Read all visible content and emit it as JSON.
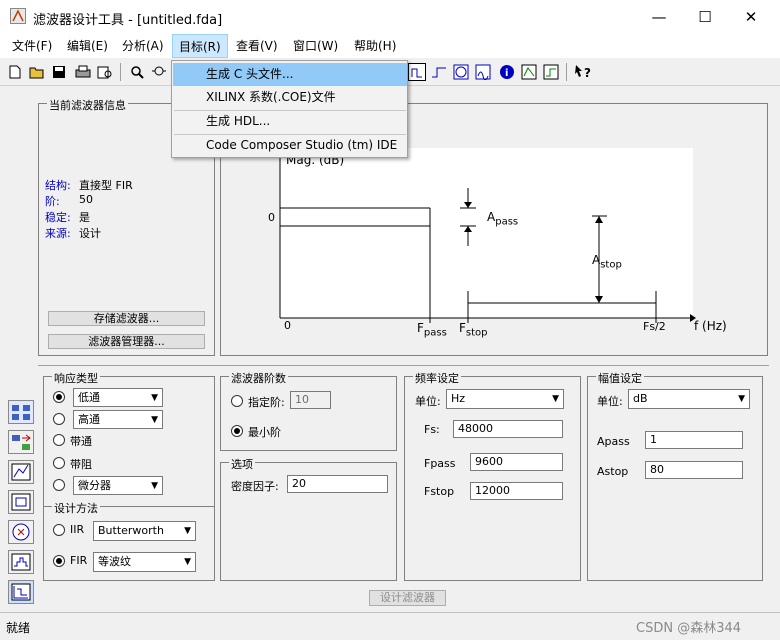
{
  "window": {
    "title": "滤波器设计工具 - [untitled.fda]",
    "minimize": "—",
    "maximize": "☐",
    "close": "✕"
  },
  "menubar": {
    "items": [
      "文件(F)",
      "编辑(E)",
      "分析(A)",
      "目标(R)",
      "查看(V)",
      "窗口(W)",
      "帮助(H)"
    ]
  },
  "dropdown": {
    "items": [
      "生成 C 头文件...",
      "XILINX 系数(.COE)文件",
      "生成 HDL...",
      "Code Composer Studio (tm) IDE"
    ]
  },
  "info_panel": {
    "legend": "当前滤波器信息",
    "rows": [
      {
        "key": "结构:",
        "value": "直接型 FIR"
      },
      {
        "key": "阶:",
        "value": "50"
      },
      {
        "key": "稳定:",
        "value": "是"
      },
      {
        "key": "来源:",
        "value": "设计"
      }
    ],
    "store_button": "存储滤波器...",
    "manager_button": "滤波器管理器..."
  },
  "plot": {
    "ylabel": "Mag. (dB)",
    "zero_y": "0",
    "zero_x": "0",
    "apass": "A",
    "apass_sub": "pass",
    "astop": "A",
    "astop_sub": "stop",
    "fpass": "F",
    "fpass_sub": "pass",
    "fstop": "F",
    "fstop_sub": "stop",
    "fs2": "Fs/2",
    "xlabel": "f (Hz)"
  },
  "response_type": {
    "legend": "响应类型",
    "options": [
      "低通",
      "高通",
      "带通",
      "带阻",
      "微分器"
    ],
    "selected_index": 0
  },
  "design_method": {
    "legend": "设计方法",
    "iir_label": "IIR",
    "iir_value": "Butterworth",
    "fir_label": "FIR",
    "fir_value": "等波纹",
    "selected": "FIR"
  },
  "order": {
    "legend": "滤波器阶数",
    "specify_label": "指定阶:",
    "specify_value": "10",
    "min_label": "最小阶",
    "selected": "min"
  },
  "options": {
    "legend": "选项",
    "density_label": "密度因子:",
    "density_value": "20"
  },
  "freq": {
    "legend": "频率设定",
    "unit_label": "单位:",
    "unit_value": "Hz",
    "fs_label": "Fs:",
    "fs_value": "48000",
    "fpass_label": "Fpass",
    "fpass_value": "9600",
    "fstop_label": "Fstop",
    "fstop_value": "12000"
  },
  "mag": {
    "legend": "幅值设定",
    "unit_label": "单位:",
    "unit_value": "dB",
    "apass_label": "Apass",
    "apass_value": "1",
    "astop_label": "Astop",
    "astop_value": "80"
  },
  "design_button": "设计滤波器",
  "status": {
    "text": "就绪",
    "watermark": "CSDN @森林344"
  }
}
